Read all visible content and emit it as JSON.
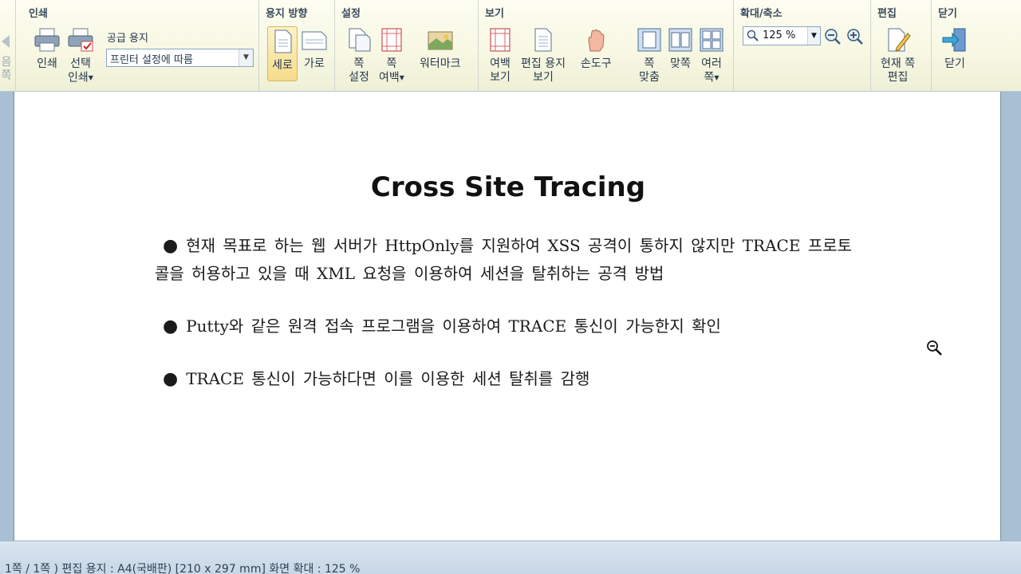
{
  "ribbon": {
    "groups": {
      "print": {
        "title": "인쇄",
        "print_label": "인쇄",
        "select_print_label_1": "선택",
        "select_print_label_2": "인쇄",
        "paper_label": "공급 용지",
        "paper_value": "프린터 설정에 따름"
      },
      "orientation": {
        "title": "용지 방향",
        "portrait_label": "세로",
        "landscape_label": "가로"
      },
      "settings": {
        "title": "설정",
        "page_setup_1": "쪽",
        "page_setup_2": "설정",
        "page_margin_1": "쪽",
        "page_margin_2": "여백",
        "watermark": "워터마크"
      },
      "view": {
        "title": "보기",
        "margin_view_1": "여백",
        "margin_view_2": "보기",
        "edit_paper_view_1": "편집 용지",
        "edit_paper_view_2": "보기",
        "hand_tool": "손도구",
        "fit_page_1": "쪽",
        "fit_page_2": "맞춤",
        "facing_pages": "맞쪽",
        "multi_page_1": "여러",
        "multi_page_2": "쪽"
      },
      "zoom": {
        "title": "확대/축소",
        "value": "125 %"
      },
      "edit": {
        "title": "편집",
        "edit_current_1": "현재 쪽",
        "edit_current_2": "편집"
      },
      "close": {
        "title": "닫기",
        "close_label": "닫기"
      }
    },
    "left_cut": {
      "label_1": "음",
      "label_2": "쪽"
    }
  },
  "document": {
    "title": "Cross Site Tracing",
    "bullets": [
      "현재 목표로 하는 웹 서버가 HttpOnly를 지원하여 XSS 공격이 통하지 않지만 TRACE 프로토콜을 허용하고 있을 때 XML 요청을 이용하여 세션을 탈취하는 공격 방법",
      "Putty와 같은 원격 접속 프로그램을 이용하여 TRACE 통신이 가능한지 확인",
      "TRACE 통신이 가능하다면 이를 이용한 세션 탈취를 감행"
    ]
  },
  "statusbar": {
    "text": "1쪽 / 1쪽 ) 편집 용지 : A4(국배판)  [210 x 297 mm]  화면 확대 : 125 %"
  }
}
